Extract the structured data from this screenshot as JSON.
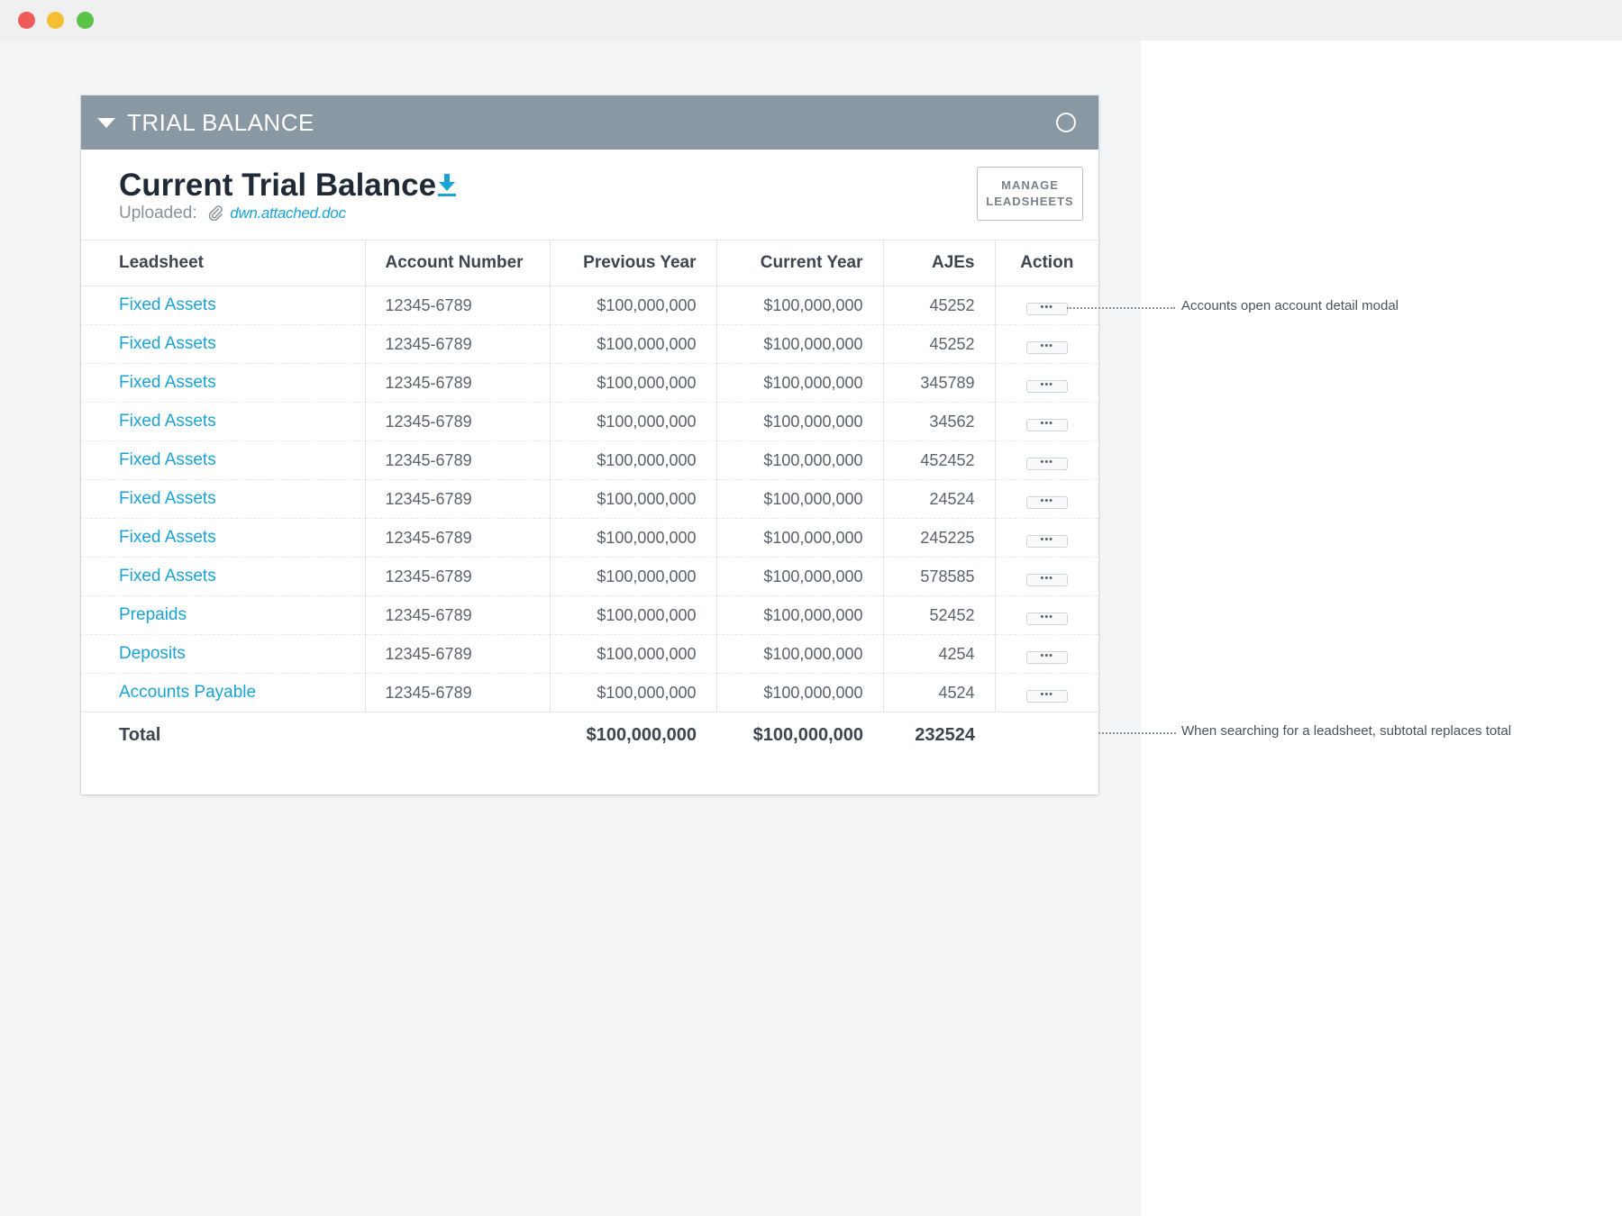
{
  "window": {
    "controls": [
      "close",
      "minimize",
      "maximize"
    ]
  },
  "panel": {
    "header_title": "TRIAL BALANCE",
    "page_title": "Current Trial Balance",
    "uploaded_label": "Uploaded:",
    "uploaded_file": "dwn.attached.doc",
    "manage_button_line1": "MANAGE",
    "manage_button_line2": "LEADSHEETS"
  },
  "table": {
    "columns": [
      "Leadsheet",
      "Account Number",
      "Previous Year",
      "Current Year",
      "AJEs",
      "Action"
    ],
    "rows": [
      {
        "leadsheet": "Fixed Assets",
        "account": "12345-6789",
        "previous": "$100,000,000",
        "current": "$100,000,000",
        "ajes": "45252",
        "action": "•••"
      },
      {
        "leadsheet": "Fixed Assets",
        "account": "12345-6789",
        "previous": "$100,000,000",
        "current": "$100,000,000",
        "ajes": "45252",
        "action": "•••"
      },
      {
        "leadsheet": "Fixed Assets",
        "account": "12345-6789",
        "previous": "$100,000,000",
        "current": "$100,000,000",
        "ajes": "345789",
        "action": "•••"
      },
      {
        "leadsheet": "Fixed Assets",
        "account": "12345-6789",
        "previous": "$100,000,000",
        "current": "$100,000,000",
        "ajes": "34562",
        "action": "•••"
      },
      {
        "leadsheet": "Fixed Assets",
        "account": "12345-6789",
        "previous": "$100,000,000",
        "current": "$100,000,000",
        "ajes": "452452",
        "action": "•••"
      },
      {
        "leadsheet": "Fixed Assets",
        "account": "12345-6789",
        "previous": "$100,000,000",
        "current": "$100,000,000",
        "ajes": "24524",
        "action": "•••"
      },
      {
        "leadsheet": "Fixed Assets",
        "account": "12345-6789",
        "previous": "$100,000,000",
        "current": "$100,000,000",
        "ajes": "245225",
        "action": "•••"
      },
      {
        "leadsheet": "Fixed Assets",
        "account": "12345-6789",
        "previous": "$100,000,000",
        "current": "$100,000,000",
        "ajes": "578585",
        "action": "•••"
      },
      {
        "leadsheet": "Prepaids",
        "account": "12345-6789",
        "previous": "$100,000,000",
        "current": "$100,000,000",
        "ajes": "52452",
        "action": "•••"
      },
      {
        "leadsheet": "Deposits",
        "account": "12345-6789",
        "previous": "$100,000,000",
        "current": "$100,000,000",
        "ajes": "4254",
        "action": "•••"
      },
      {
        "leadsheet": "Accounts Payable",
        "account": "12345-6789",
        "previous": "$100,000,000",
        "current": "$100,000,000",
        "ajes": "4524",
        "action": "•••"
      }
    ],
    "total": {
      "label": "Total",
      "previous": "$100,000,000",
      "current": "$100,000,000",
      "ajes": "232524"
    }
  },
  "annotations": {
    "accounts_note": "Accounts open account detail modal",
    "subtotal_note": "When searching for a leadsheet, subtotal replaces total"
  },
  "icons": {
    "header_toggle": "caret-down-icon",
    "header_status": "circle-icon",
    "download": "download-icon",
    "attachment": "paperclip-icon"
  },
  "colors": {
    "header_bg": "#8a98a3",
    "link": "#1aa3d4",
    "title": "#1f2a36",
    "close_dot": "#ee5b5a",
    "minimize_dot": "#f6bf33",
    "maximize_dot": "#5ac348"
  }
}
